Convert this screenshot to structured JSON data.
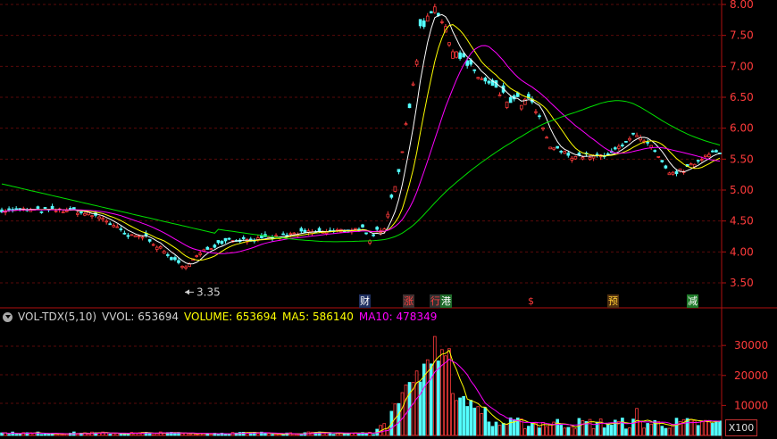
{
  "colors": {
    "up": "#ff3b3b",
    "down": "#54ffff",
    "ma_white": "#ffffff",
    "ma_yellow": "#ffff00",
    "ma_magenta": "#ff00ff",
    "ma_green": "#00e000",
    "axis": "#b01010",
    "axis_label": "#ff3b3b"
  },
  "price_axis": {
    "ticks": [
      "8.00",
      "7.50",
      "7.00",
      "6.50",
      "6.00",
      "5.50",
      "5.00",
      "4.50",
      "4.00",
      "3.50"
    ],
    "range": [
      3.3,
      8.05
    ]
  },
  "low_marker": "3.35",
  "events": [
    {
      "label": "财",
      "color": "#ffffff",
      "bg": "#203060"
    },
    {
      "label": "涨",
      "color": "#ff4040",
      "bg": "#403030"
    },
    {
      "label": "行",
      "color": "#ff4040",
      "bg": "#303030"
    },
    {
      "label": "港",
      "color": "#ffffff",
      "bg": "#1f6a2a"
    },
    {
      "label": "$",
      "color": "#ff3b3b",
      "bg": "transparent"
    },
    {
      "label": "预",
      "color": "#ffcc33",
      "bg": "#503010"
    },
    {
      "label": "减",
      "color": "#ffffff",
      "bg": "#1f7a2a"
    }
  ],
  "indicator": {
    "name": "VOL-TDX(5,10)",
    "vvol_label": "VVOL: 653694",
    "volume_label": "VOLUME: 653694",
    "ma5_label": "MA5: 586140",
    "ma10_label": "MA10: 478349"
  },
  "volume_axis": {
    "ticks": [
      "30000",
      "20000",
      "10000"
    ],
    "unit": "X100"
  }
}
